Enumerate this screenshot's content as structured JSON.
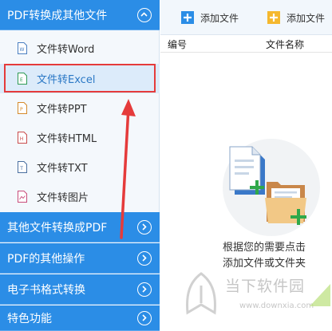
{
  "sidebar": {
    "sections": [
      {
        "title": "PDF转换成其他文件",
        "expanded": true
      },
      {
        "title": "其他文件转换成PDF",
        "expanded": false
      },
      {
        "title": "PDF的其他操作",
        "expanded": false
      },
      {
        "title": "电子书格式转换",
        "expanded": false
      },
      {
        "title": "特色功能",
        "expanded": false
      }
    ],
    "items": [
      {
        "label": "文件转Word",
        "icon": "word-file-icon",
        "selected": false
      },
      {
        "label": "文件转Excel",
        "icon": "excel-file-icon",
        "selected": true
      },
      {
        "label": "文件转PPT",
        "icon": "ppt-file-icon",
        "selected": false
      },
      {
        "label": "文件转HTML",
        "icon": "html-file-icon",
        "selected": false
      },
      {
        "label": "文件转TXT",
        "icon": "txt-file-icon",
        "selected": false
      },
      {
        "label": "文件转图片",
        "icon": "image-file-icon",
        "selected": false
      }
    ]
  },
  "toolbar": {
    "add_file_label": "添加文件",
    "add_folder_label": "添加文件"
  },
  "table": {
    "columns": [
      "编号",
      "文件名称"
    ]
  },
  "empty_state": {
    "hint_line1": "根据您的需要点击",
    "hint_line2": "添加文件或文件夹"
  },
  "watermark": {
    "brand": "当下软件园",
    "url": "www.downxia.com"
  },
  "colors": {
    "primary": "#2b8de6",
    "selected_bg": "#dcebfa",
    "annotation_red": "#e53b3b"
  }
}
